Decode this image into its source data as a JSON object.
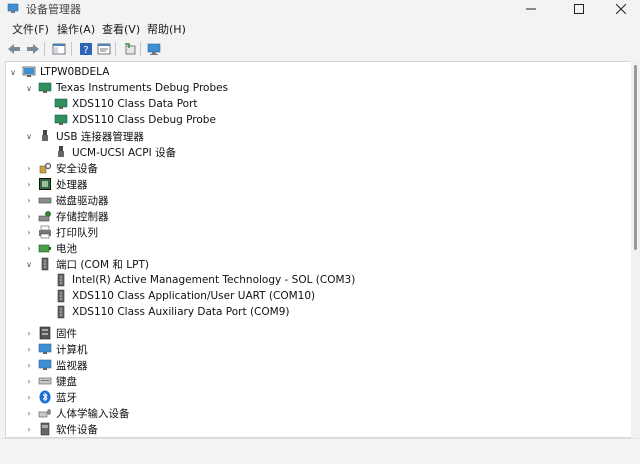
{
  "window": {
    "title": "设备管理器"
  },
  "menu": [
    "文件(F)",
    "操作(A)",
    "查看(V)",
    "帮助(H)"
  ],
  "tree": {
    "root": "LTPW0BDELA",
    "items": [
      {
        "label": "Texas Instruments Debug Probes",
        "expanded": true,
        "icon": "monitor-icon",
        "children": [
          "XDS110 Class Data Port",
          "XDS110 Class Debug Probe"
        ]
      },
      {
        "label": "USB 连接器管理器",
        "expanded": true,
        "icon": "usb-icon",
        "children": [
          "UCM-UCSI ACPI 设备"
        ]
      },
      {
        "label": "安全设备",
        "icon": "security-icon"
      },
      {
        "label": "处理器",
        "icon": "processor-icon"
      },
      {
        "label": "磁盘驱动器",
        "icon": "disk-icon"
      },
      {
        "label": "存储控制器",
        "icon": "storage-icon"
      },
      {
        "label": "打印队列",
        "icon": "printer-icon"
      },
      {
        "label": "电池",
        "icon": "battery-icon"
      },
      {
        "label": "端口 (COM 和 LPT)",
        "expanded": true,
        "icon": "port-icon",
        "children": [
          "Intel(R) Active Management Technology - SOL (COM3)",
          "XDS110 Class Application/User UART (COM10)",
          "XDS110 Class Auxiliary Data Port (COM9)"
        ]
      },
      {
        "label": "固件",
        "icon": "firmware-icon"
      },
      {
        "label": "计算机",
        "icon": "computer-icon"
      },
      {
        "label": "监视器",
        "icon": "monitor-icon"
      },
      {
        "label": "键盘",
        "icon": "keyboard-icon"
      },
      {
        "label": "蓝牙",
        "icon": "bluetooth-icon"
      },
      {
        "label": "人体学输入设备",
        "icon": "hid-icon"
      },
      {
        "label": "软件设备",
        "icon": "software-icon"
      }
    ]
  }
}
